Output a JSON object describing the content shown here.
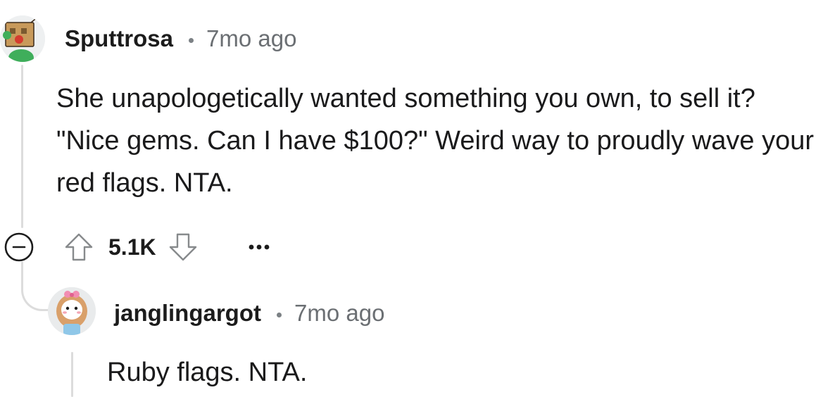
{
  "comment": {
    "username": "Sputtrosa",
    "timestamp": "7mo ago",
    "body": "She unapologetically wanted something you own, to sell it? \"Nice gems. Can I have $100?\" Weird way to proudly wave your red flags. NTA.",
    "score": "5.1K",
    "icons": {
      "collapse": "collapse-minus-icon",
      "upvote": "upvote-arrow-icon",
      "downvote": "downvote-arrow-icon",
      "more": "more-options-icon"
    }
  },
  "reply": {
    "username": "janglingargot",
    "timestamp": "7mo ago",
    "body": "Ruby flags. NTA."
  },
  "colors": {
    "text": "#1a1a1b",
    "muted": "#6b6f73",
    "thread_line": "#dcdcdc",
    "icon_stroke": "#878a8c"
  }
}
